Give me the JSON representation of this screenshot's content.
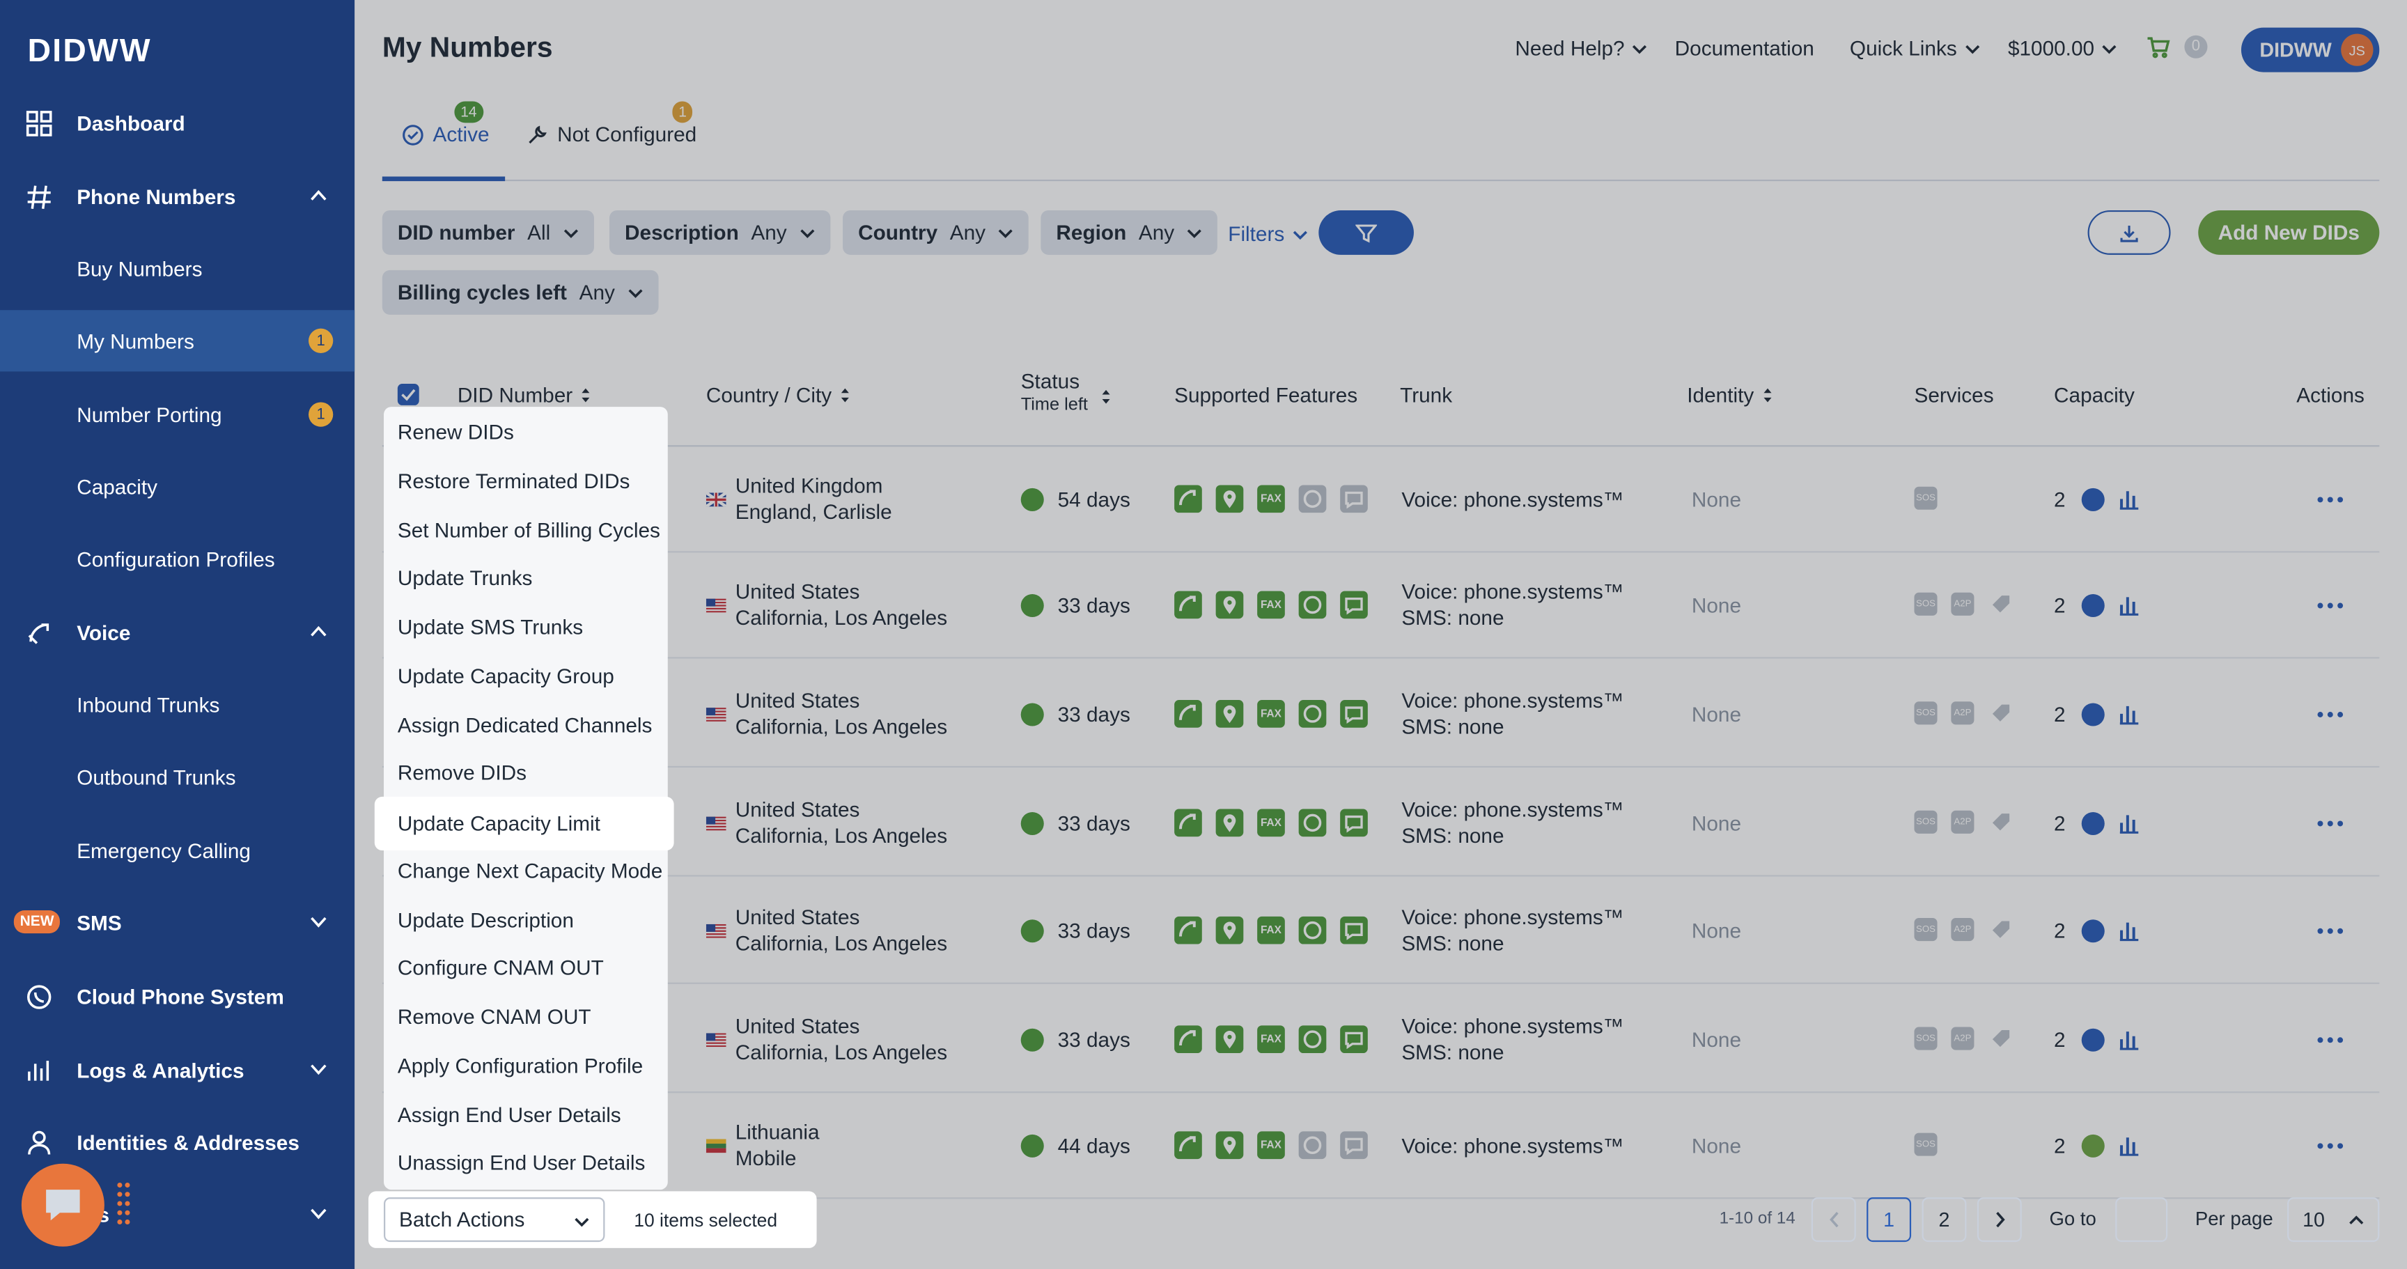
{
  "sidebar": {
    "logo": "DIDWW",
    "items": [
      {
        "label": "Dashboard"
      },
      {
        "label": "Phone Numbers"
      },
      {
        "label": "Buy Numbers"
      },
      {
        "label": "My Numbers",
        "badge": "1"
      },
      {
        "label": "Number Porting",
        "badge": "1"
      },
      {
        "label": "Capacity"
      },
      {
        "label": "Configuration Profiles"
      },
      {
        "label": "Voice"
      },
      {
        "label": "Inbound Trunks"
      },
      {
        "label": "Outbound Trunks"
      },
      {
        "label": "Emergency Calling"
      },
      {
        "label": "SMS",
        "tag": "NEW"
      },
      {
        "label": "Cloud Phone System"
      },
      {
        "label": "Logs & Analytics"
      },
      {
        "label": "Identities & Addresses"
      },
      {
        "label": "ls"
      }
    ]
  },
  "header": {
    "title": "My Numbers",
    "help": "Need Help?",
    "docs": "Documentation",
    "quick_links": "Quick Links",
    "balance": "$1000.00",
    "cart_count": "0",
    "account": "DIDWW",
    "avatar": "JS"
  },
  "tabs": [
    {
      "label": "Active",
      "count": "14"
    },
    {
      "label": "Not Configured",
      "count": "1"
    }
  ],
  "filters": {
    "did_number": {
      "label": "DID number",
      "value": "All"
    },
    "description": {
      "label": "Description",
      "value": "Any"
    },
    "country": {
      "label": "Country",
      "value": "Any"
    },
    "region": {
      "label": "Region",
      "value": "Any"
    },
    "more": "Filters",
    "billing_cycles": {
      "label": "Billing cycles left",
      "value": "Any"
    },
    "add_button": "Add New DIDs"
  },
  "table": {
    "columns": {
      "did": "DID Number",
      "country": "Country / City",
      "status": "Status",
      "time_left": "Time left",
      "features": "Supported Features",
      "trunk": "Trunk",
      "identity": "Identity",
      "services": "Services",
      "capacity": "Capacity",
      "actions": "Actions"
    },
    "rows": [
      {
        "country": "United Kingdom",
        "city": "England, Carlisle",
        "days": "54 days",
        "trunk": "Voice: phone.systems™",
        "sms": "",
        "identity": "None",
        "capacity": "2"
      },
      {
        "country": "United States",
        "city": "California, Los Angeles",
        "days": "33 days",
        "trunk": "Voice: phone.systems™",
        "sms": "SMS: none",
        "identity": "None",
        "capacity": "2"
      },
      {
        "country": "United States",
        "city": "California, Los Angeles",
        "days": "33 days",
        "trunk": "Voice: phone.systems™",
        "sms": "SMS: none",
        "identity": "None",
        "capacity": "2"
      },
      {
        "country": "United States",
        "city": "California, Los Angeles",
        "days": "33 days",
        "trunk": "Voice: phone.systems™",
        "sms": "SMS: none",
        "identity": "None",
        "capacity": "2"
      },
      {
        "country": "United States",
        "city": "California, Los Angeles",
        "days": "33 days",
        "trunk": "Voice: phone.systems™",
        "sms": "SMS: none",
        "identity": "None",
        "capacity": "2"
      },
      {
        "country": "United States",
        "city": "California, Los Angeles",
        "days": "33 days",
        "trunk": "Voice: phone.systems™",
        "sms": "SMS: none",
        "identity": "None",
        "capacity": "2"
      },
      {
        "country": "Lithuania",
        "city": "Mobile",
        "days": "44 days",
        "trunk": "Voice: phone.systems™",
        "sms": "",
        "identity": "None",
        "capacity": "2"
      }
    ]
  },
  "features": {
    "fax": "FAX",
    "sos": "SOS",
    "a2p": "A2P"
  },
  "batch_menu": [
    "Renew DIDs",
    "Restore Terminated DIDs",
    "Set Number of Billing Cycles",
    "Update Trunks",
    "Update SMS Trunks",
    "Update Capacity Group",
    "Assign Dedicated Channels",
    "Remove DIDs",
    "Update Capacity Limit",
    "Change Next Capacity Mode",
    "Update Description",
    "Configure CNAM OUT",
    "Remove CNAM OUT",
    "Apply Configuration Profile",
    "Assign End User Details",
    "Unassign End User Details"
  ],
  "batch": {
    "select_label": "Batch Actions",
    "selected_count": "10 items selected"
  },
  "pagination": {
    "range": "1-10 of 14",
    "page1": "1",
    "page2": "2",
    "goto": "Go to",
    "per_page_label": "Per page",
    "per_page": "10"
  },
  "colors": {
    "sidebar": "#1d3c78",
    "accent": "#2a5db8",
    "feature_green": "#4e9a3c",
    "add_button": "#6da544",
    "orange": "#e8763c"
  }
}
